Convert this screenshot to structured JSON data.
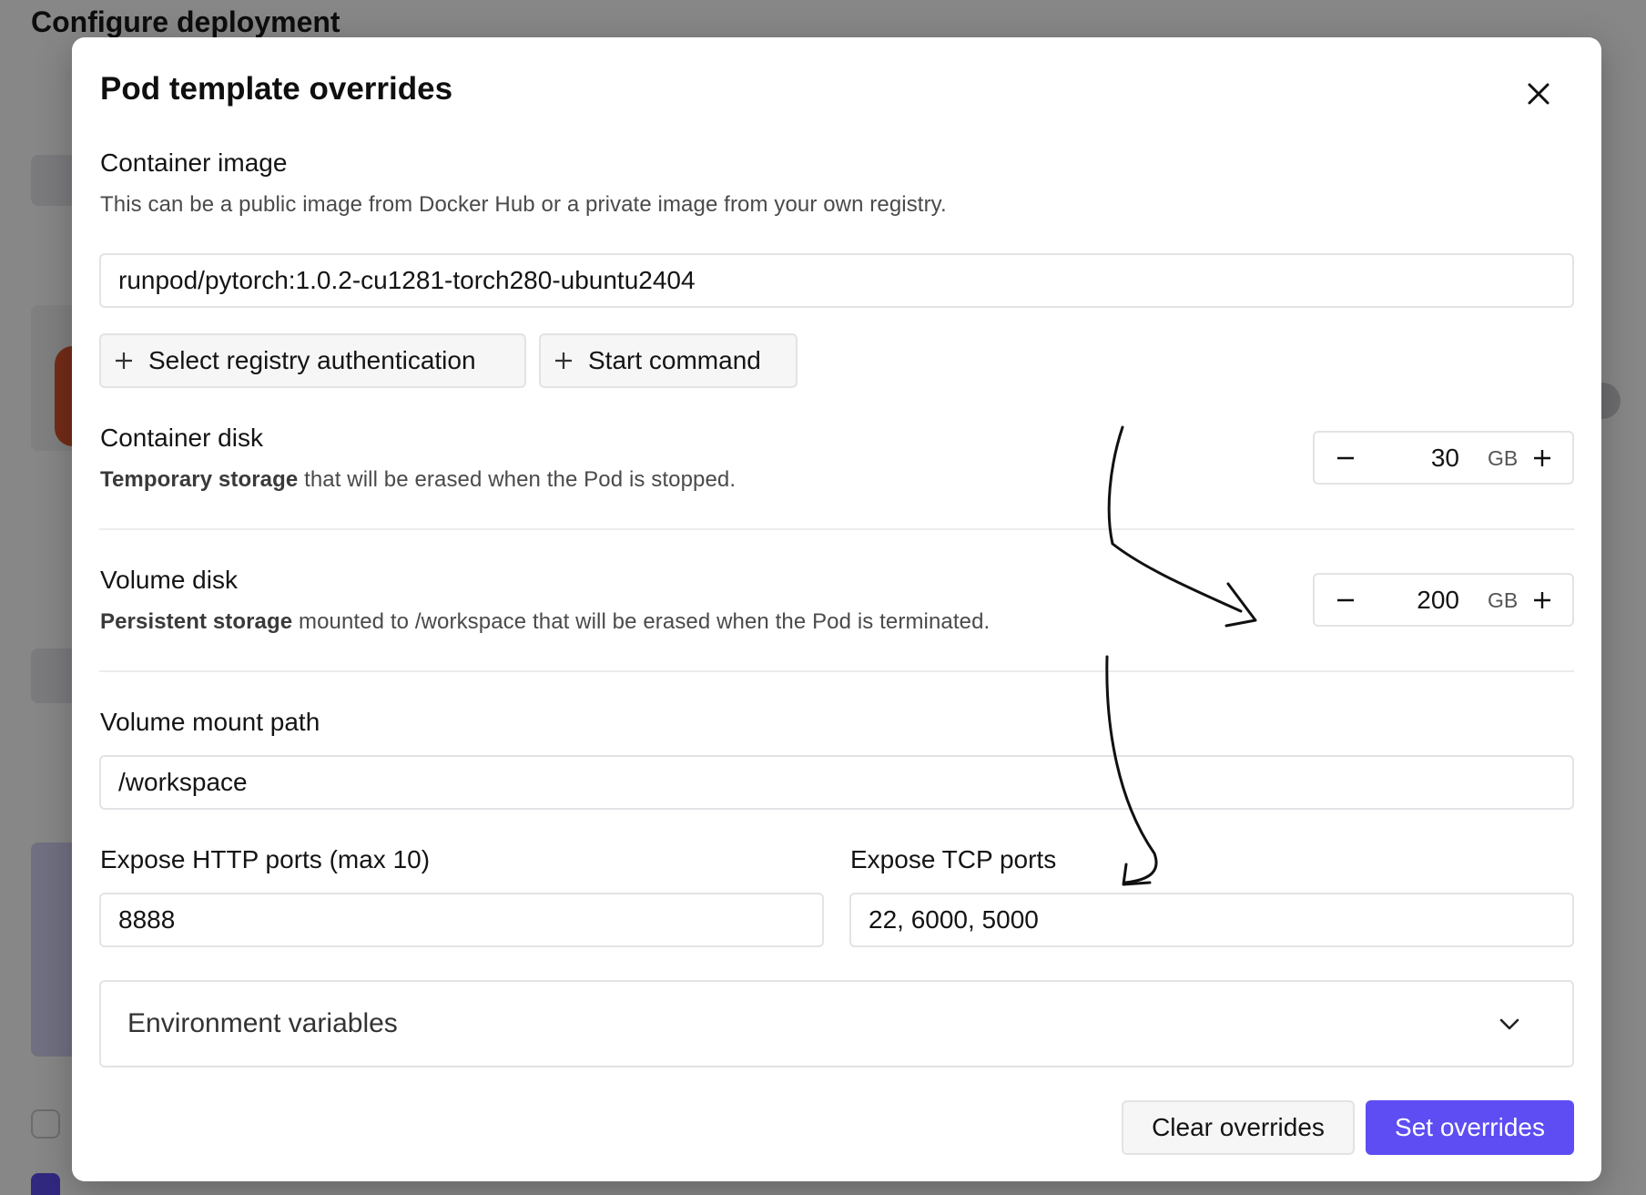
{
  "background": {
    "title": "Configure deployment"
  },
  "modal": {
    "title": "Pod template overrides",
    "container_image": {
      "label": "Container image",
      "description": "This can be a public image from Docker Hub or a private image from your own registry.",
      "value": "runpod/pytorch:1.0.2-cu1281-torch280-ubuntu2404"
    },
    "buttons": {
      "registry_auth": "Select registry authentication",
      "start_command": "Start command"
    },
    "container_disk": {
      "label": "Container disk",
      "desc_bold": "Temporary storage",
      "desc_rest": " that will be erased when the Pod is stopped.",
      "value": "30",
      "unit": "GB"
    },
    "volume_disk": {
      "label": "Volume disk",
      "desc_bold": "Persistent storage",
      "desc_rest": " mounted to /workspace that will be erased when the Pod is terminated.",
      "value": "200",
      "unit": "GB"
    },
    "volume_mount": {
      "label": "Volume mount path",
      "value": "/workspace"
    },
    "http_ports": {
      "label": "Expose HTTP ports (max 10)",
      "value": "8888"
    },
    "tcp_ports": {
      "label": "Expose TCP ports",
      "value": "22, 6000, 5000"
    },
    "env_vars": {
      "label": "Environment variables"
    },
    "footer": {
      "clear": "Clear overrides",
      "set": "Set overrides"
    }
  },
  "colors": {
    "primary": "#5d4df2",
    "border": "#e3e3e6",
    "overlay": "#7a7a7a"
  },
  "icons": {
    "close": "close-icon",
    "plus": "plus-icon",
    "minus": "minus-icon",
    "chevron": "chevron-down-icon"
  }
}
